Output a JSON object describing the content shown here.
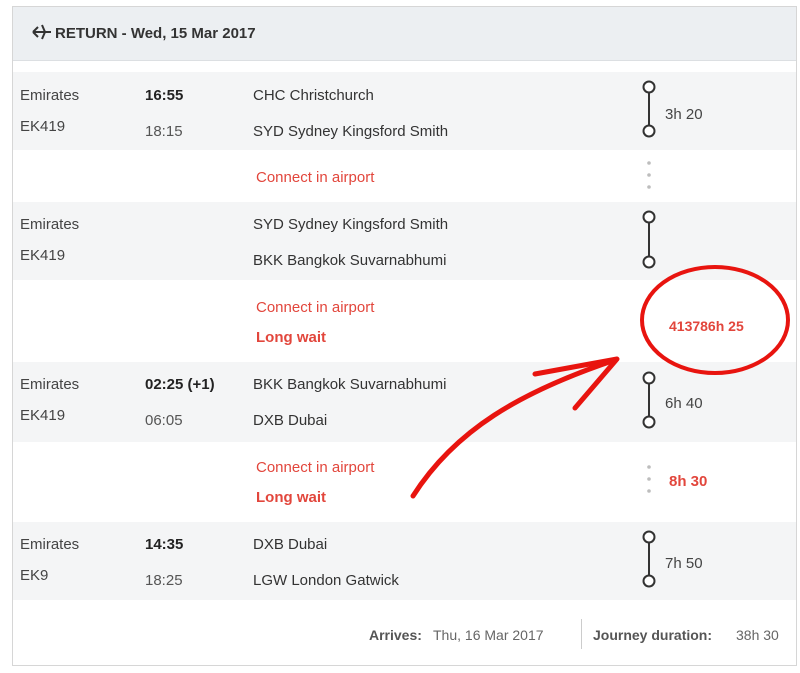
{
  "header": {
    "title": "RETURN - Wed, 15 Mar 2017",
    "icon": "plane-return-icon"
  },
  "segments": [
    {
      "airline": "Emirates",
      "flight": "EK419",
      "dep_time": "16:55",
      "arr_time": "18:15",
      "from": "CHC Christchurch",
      "to": "SYD Sydney Kingsford Smith",
      "duration": "3h 20"
    },
    {
      "airline": "Emirates",
      "flight": "EK419",
      "dep_time": "",
      "arr_time": "",
      "from": "SYD Sydney Kingsford Smith",
      "to": "BKK Bangkok Suvarnabhumi",
      "duration": ""
    },
    {
      "airline": "Emirates",
      "flight": "EK419",
      "dep_time": "02:25 (+1)",
      "arr_time": "06:05",
      "from": "BKK Bangkok Suvarnabhumi",
      "to": "DXB Dubai",
      "duration": "6h 40"
    },
    {
      "airline": "Emirates",
      "flight": "EK9",
      "dep_time": "14:35",
      "arr_time": "18:25",
      "from": "DXB Dubai",
      "to": "LGW London Gatwick",
      "duration": "7h 50"
    }
  ],
  "connections": [
    {
      "label": "Connect in airport",
      "wait": "",
      "duration": ""
    },
    {
      "label": "Connect in airport",
      "wait": "Long wait",
      "duration": "413786h 25"
    },
    {
      "label": "Connect in airport",
      "wait": "Long wait",
      "duration": "8h 30"
    }
  ],
  "footer": {
    "arrives_label": "Arrives:",
    "arrives_value": "Thu, 16 Mar 2017",
    "journey_label": "Journey duration:",
    "journey_value": "38h 30"
  },
  "colors": {
    "accent_red": "#e2463c",
    "annotation_red": "#e8140f",
    "header_bg": "#eceff2",
    "band_gray": "#f4f5f6"
  }
}
